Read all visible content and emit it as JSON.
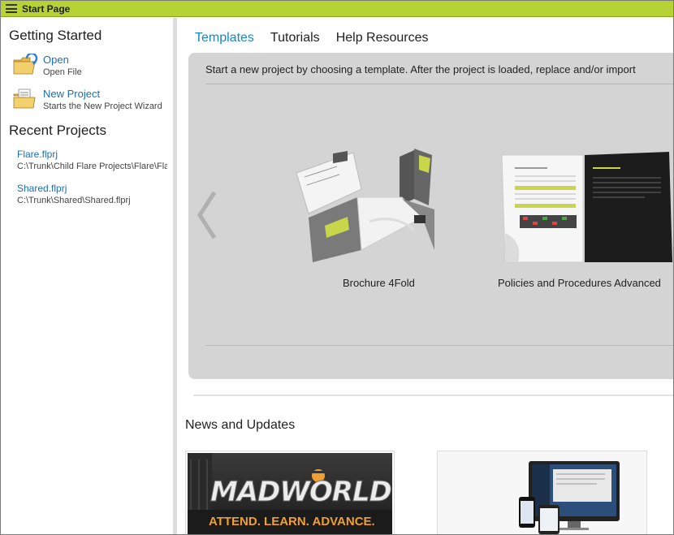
{
  "window": {
    "title": "Start Page"
  },
  "sidebar": {
    "getting_started": "Getting Started",
    "open": {
      "label": "Open",
      "sub": "Open File"
    },
    "new_project": {
      "label": "New Project",
      "sub": "Starts the New Project Wizard"
    },
    "recent_heading": "Recent Projects",
    "recent": [
      {
        "name": "Flare.flprj",
        "path": "C:\\Trunk\\Child Flare Projects\\Flare\\Flare.flprj"
      },
      {
        "name": "Shared.flprj",
        "path": "C:\\Trunk\\Shared\\Shared.flprj"
      }
    ]
  },
  "main": {
    "tabs": [
      {
        "label": "Templates",
        "active": true
      },
      {
        "label": "Tutorials",
        "active": false
      },
      {
        "label": "Help Resources",
        "active": false
      }
    ],
    "intro": "Start a new project by choosing a template. After the project is loaded, replace and/or import",
    "templates": [
      {
        "label": "Brochure 4Fold"
      },
      {
        "label": "Policies and Procedures Advanced"
      }
    ],
    "news_heading": "News and Updates",
    "news": [
      {
        "title": "MADWORLD",
        "tagline": "ATTEND. LEARN. ADVANCE."
      }
    ]
  },
  "colors": {
    "titlebar": "#b5d334",
    "link": "#1a6fb5",
    "active_tab": "#1a86c8",
    "madworld_orange": "#f0a030"
  }
}
